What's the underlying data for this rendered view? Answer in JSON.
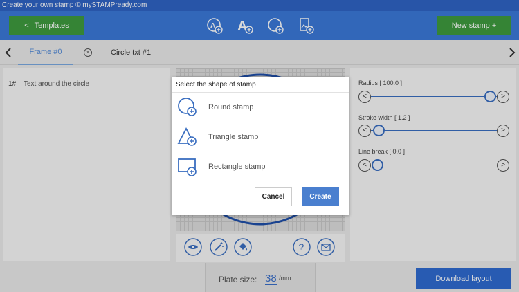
{
  "app": {
    "title": "Create your own stamp © mySTAMPready.com"
  },
  "header": {
    "templates_label": "Templates",
    "templates_chevron": "<",
    "new_stamp_label": "New stamp +",
    "tools": [
      "add-circle-frame-icon",
      "add-text-icon",
      "add-round-icon",
      "add-image-icon"
    ]
  },
  "tabs": {
    "prev_arrow": "<",
    "next_arrow": ">",
    "items": [
      {
        "label": "Frame #0",
        "active": true
      },
      {
        "label": "Circle txt #1",
        "active": false
      }
    ],
    "close_glyph": "×"
  },
  "left_panel": {
    "row_number": "1#",
    "text_value": "Text around the circle"
  },
  "right_panel": {
    "radius_label": "Radius [ 100.0 ]",
    "radius_value": 100.0,
    "stroke_label": "Stroke width [ 1.2 ]",
    "stroke_value": 1.2,
    "linebreak_label": "Line break [ 0.0 ]",
    "linebreak_value": 0.0,
    "dec_glyph": "<",
    "inc_glyph": ">"
  },
  "canvas_tools": [
    "eye-icon",
    "magic-wand-icon",
    "paint-bucket-icon",
    "help-icon",
    "mail-icon"
  ],
  "footer": {
    "plate_label": "Plate size:",
    "plate_value": "38",
    "plate_unit": "/mm",
    "download_label": "Download layout"
  },
  "modal": {
    "title": "Select the shape of stamp",
    "options": [
      {
        "label": "Round stamp",
        "icon": "round-stamp-icon"
      },
      {
        "label": "Triangle stamp",
        "icon": "triangle-stamp-icon"
      },
      {
        "label": "Rectangle stamp",
        "icon": "rectangle-stamp-icon"
      }
    ],
    "cancel_label": "Cancel",
    "create_label": "Create"
  },
  "colors": {
    "header_blue": "#3b79d8",
    "green_button": "#3e9a3e",
    "accent_blue": "#2f6bd0",
    "icon_blue": "#3a6ec0"
  }
}
